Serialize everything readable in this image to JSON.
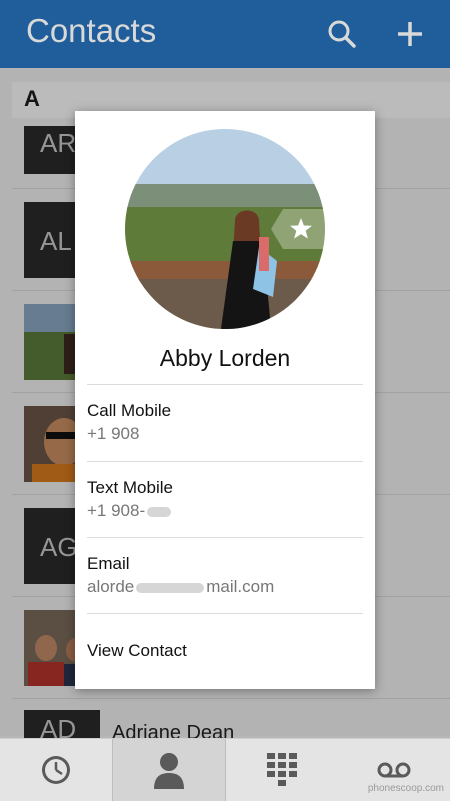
{
  "header": {
    "title": "Contacts",
    "search_icon": "search-icon",
    "add_icon": "plus-icon"
  },
  "list": {
    "section_letter": "A",
    "rows": [
      {
        "initials": "AR"
      },
      {
        "initials": "AL"
      },
      {
        "initials": ""
      },
      {
        "initials": ""
      },
      {
        "initials": "AG"
      },
      {
        "initials": ""
      },
      {
        "initials": "AD",
        "name": "Adriane Dean"
      }
    ]
  },
  "dialog": {
    "name": "Abby Lorden",
    "favorite_icon": "star-icon",
    "actions": [
      {
        "label": "Call Mobile",
        "value": "+1 908"
      },
      {
        "label": "Text Mobile",
        "value": "+1 908-"
      },
      {
        "label": "Email",
        "value_start": "alorde",
        "value_end": "mail.com"
      }
    ],
    "view_contact": "View Contact"
  },
  "bottom_nav": {
    "tabs": [
      {
        "icon": "clock-icon"
      },
      {
        "icon": "person-icon"
      },
      {
        "icon": "dialpad-icon"
      },
      {
        "icon": "voicemail-icon"
      }
    ]
  },
  "watermark": "phonescoop.com"
}
